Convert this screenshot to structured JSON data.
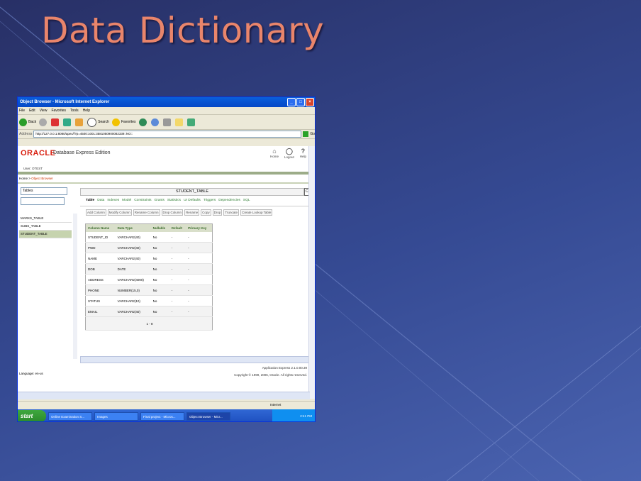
{
  "slide": {
    "title": "Data Dictionary"
  },
  "window": {
    "title": "Object Browser - Microsoft Internet Explorer"
  },
  "menu": [
    "File",
    "Edit",
    "View",
    "Favorites",
    "Tools",
    "Help"
  ],
  "toolbar": {
    "back": "Back",
    "search": "Search",
    "favorites": "Favorites"
  },
  "address": {
    "label": "Address",
    "url": "http://127.0.0.1:8080/apex/f?p=4500:1001:3581050900082339::NO::",
    "go": "Go"
  },
  "header": {
    "brand": "ORACLE",
    "product": "Database Express Edition",
    "icons": [
      {
        "name": "Home",
        "glyph": "⌂"
      },
      {
        "name": "Logout",
        "glyph": "◯"
      },
      {
        "name": "Help",
        "glyph": "?"
      }
    ],
    "user": "User: OTEST"
  },
  "breadcrumb": {
    "home": "Home >",
    "current": "Object Browser"
  },
  "left": {
    "selector": "Tables",
    "items": [
      {
        "label": "MARKS_TABLE",
        "selected": false
      },
      {
        "label": "SUBS_TABLE",
        "selected": false
      },
      {
        "label": "STUDENT_TABLE",
        "selected": true
      }
    ]
  },
  "main": {
    "table_name": "STUDENT_TABLE",
    "cm_label": "Cre",
    "tabs": [
      "Table",
      "Data",
      "Indexes",
      "Model",
      "Constraints",
      "Grants",
      "Statistics",
      "UI Defaults",
      "Triggers",
      "Dependencies",
      "SQL"
    ],
    "actions": [
      "Add Column",
      "Modify Column",
      "Rename Column",
      "Drop Column",
      "Rename",
      "Copy",
      "Drop",
      "Truncate",
      "Create Lookup Table"
    ],
    "columns": [
      "Column Name",
      "Data Type",
      "Nullable",
      "Default",
      "Primary Key"
    ],
    "rows": [
      [
        "STUDENT_ID",
        "VARCHAR2(40)",
        "No",
        "-",
        "-"
      ],
      [
        "PWD",
        "VARCHAR2(40)",
        "No",
        "-",
        "-"
      ],
      [
        "NAME",
        "VARCHAR2(40)",
        "No",
        "-",
        "-"
      ],
      [
        "DOB",
        "DATE",
        "No",
        "-",
        "-"
      ],
      [
        "ADDRESS",
        "VARCHAR2(4000)",
        "No",
        "-",
        "-"
      ],
      [
        "PHONE",
        "NUMBER(15,0)",
        "No",
        "-",
        "-"
      ],
      [
        "STATUS",
        "VARCHAR2(10)",
        "No",
        "-",
        "-"
      ],
      [
        "EMAIL",
        "VARCHAR2(40)",
        "No",
        "-",
        "-"
      ]
    ],
    "pagination": "1 - 8"
  },
  "footer": {
    "app_version": "Application Express 2.1.0.00.39",
    "copyright": "Copyright © 1999, 2006, Oracle. All rights reserved.",
    "language": "Language: en-us"
  },
  "statusbar": {
    "zone": "Internet"
  },
  "taskbar": {
    "start": "start",
    "tasks": [
      "Online Examination S...",
      "Images",
      "Final project - Micros...",
      "Object Browser - Micr..."
    ],
    "clock": "2:41 PM"
  },
  "colors": {
    "slide_title": "#e9856b",
    "oracle_red": "#d81f0f",
    "xp_blue": "#0548c6"
  }
}
